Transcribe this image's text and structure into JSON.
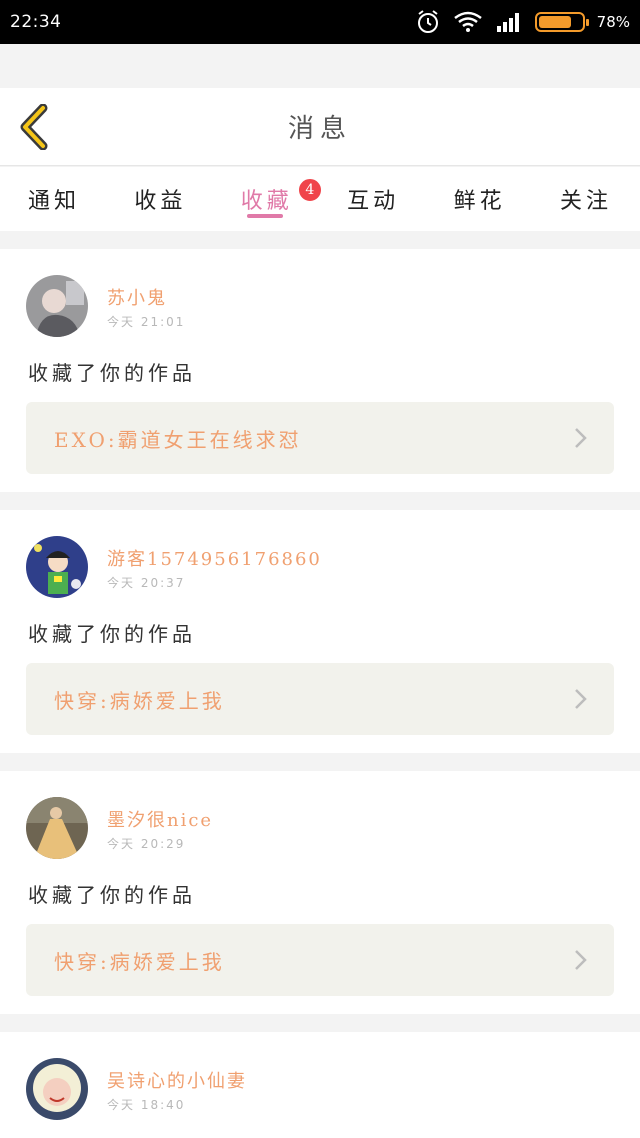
{
  "status_bar": {
    "time": "22:34",
    "battery": "78%",
    "battery_level": 0.78
  },
  "header": {
    "title": "消息"
  },
  "tabs": [
    {
      "label": "通知"
    },
    {
      "label": "收益"
    },
    {
      "label": "收藏",
      "badge": "4"
    },
    {
      "label": "互动"
    },
    {
      "label": "鲜花"
    },
    {
      "label": "关注"
    }
  ],
  "notifications": [
    {
      "username": "苏小鬼",
      "time": "今天 21:01",
      "action": "收藏了你的作品",
      "work_title": "EXO:霸道女王在线求怼",
      "avatar_icon": "avatar-photo-icon"
    },
    {
      "username": "游客1574956176860",
      "time": "今天 20:37",
      "action": "收藏了你的作品",
      "work_title": "快穿:病娇爱上我",
      "avatar_icon": "avatar-cartoon-icon"
    },
    {
      "username": "墨汐很nice",
      "time": "今天 20:29",
      "action": "收藏了你的作品",
      "work_title": "快穿:病娇爱上我",
      "avatar_icon": "avatar-dress-icon"
    },
    {
      "username": "吴诗心的小仙妻",
      "time": "今天 18:40",
      "avatar_icon": "avatar-face-icon"
    }
  ],
  "colors": {
    "accent": "#e07aa8",
    "name": "#f0a070",
    "badge": "#f0444a",
    "back_arrow": "#f5c518"
  }
}
